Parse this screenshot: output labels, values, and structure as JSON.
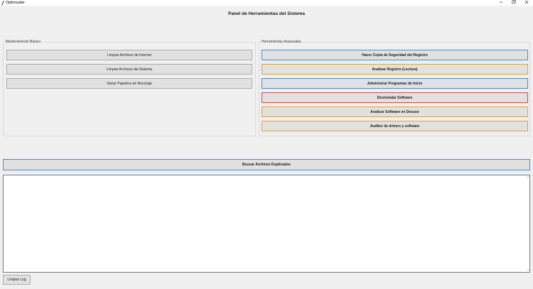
{
  "window": {
    "title": "Optimizador",
    "controls": [
      "minimize-icon",
      "restore-icon",
      "close-icon"
    ]
  },
  "panel_title": "Panel de Herramientas del Sistema",
  "basic": {
    "label": "Mantenimiento Básico",
    "buttons": [
      "Limpiar Archivos de Internet",
      "Limpiar Archivos del Sistema",
      "Vaciar Papelera de Reciclaje"
    ]
  },
  "advanced": {
    "label": "Herramientas Avanzadas",
    "buttons": [
      {
        "label": "Hacer Copia de Seguridad del Registro",
        "accent": "#3d8fd4"
      },
      {
        "label": "Analizar Registro (Lectura)",
        "accent": "#e0a62a"
      },
      {
        "label": "Administrar Programas de Inicio",
        "accent": "#3d8fd4"
      },
      {
        "label": "Desinstalar Software",
        "accent": "#d94848"
      },
      {
        "label": "Analizar Software en Desuso",
        "accent": "#e0a62a"
      },
      {
        "label": "Auditor de drivers y software",
        "accent": "#e0a62a"
      }
    ]
  },
  "duplicates_button": "Buscar Archivos Duplicados",
  "log": {
    "content": ""
  },
  "clear_log_button": "Limpiar Log"
}
